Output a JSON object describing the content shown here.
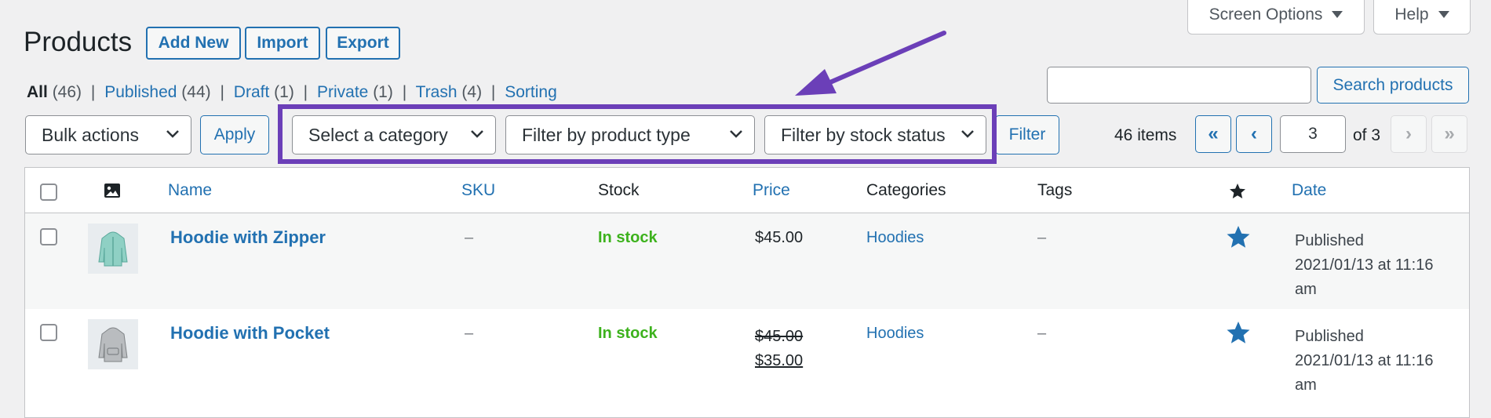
{
  "header": {
    "title": "Products",
    "add_new": "Add New",
    "import": "Import",
    "export": "Export",
    "screen_options": "Screen Options",
    "help": "Help"
  },
  "views": [
    {
      "label": "All",
      "count": "(46)"
    },
    {
      "label": "Published",
      "count": "(44)"
    },
    {
      "label": "Draft",
      "count": "(1)"
    },
    {
      "label": "Private",
      "count": "(1)"
    },
    {
      "label": "Trash",
      "count": "(4)"
    },
    {
      "label": "Sorting",
      "count": ""
    }
  ],
  "separator": "|",
  "search": {
    "value": "",
    "button": "Search products"
  },
  "filters": {
    "bulk_actions": "Bulk actions",
    "apply": "Apply",
    "category": "Select a category",
    "product_type": "Filter by product type",
    "stock_status": "Filter by stock status",
    "filter_button": "Filter"
  },
  "pagination": {
    "items": "46 items",
    "first": "«",
    "prev": "‹",
    "current": "3",
    "of": "of 3",
    "next": "›",
    "last": "»"
  },
  "columns": {
    "name": "Name",
    "sku": "SKU",
    "stock": "Stock",
    "price": "Price",
    "categories": "Categories",
    "tags": "Tags",
    "date": "Date"
  },
  "rows": [
    {
      "name": "Hoodie with Zipper",
      "sku": "–",
      "stock": "In stock",
      "price": "$45.00",
      "categories": "Hoodies",
      "tags": "–",
      "date_status": "Published",
      "date_line1": "2021/01/13 at 11:16",
      "date_line2": "am"
    },
    {
      "name": "Hoodie with Pocket",
      "sku": "–",
      "stock": "In stock",
      "price_regular": "$45.00",
      "price_sale": "$35.00",
      "categories": "Hoodies",
      "tags": "–",
      "date_status": "Published",
      "date_line1": "2021/01/13 at 11:16",
      "date_line2": "am"
    }
  ],
  "colors": {
    "accent": "#2271b1",
    "highlight": "#6b3fb8",
    "in_stock": "#3db21d",
    "background": "#f0f0f1"
  }
}
